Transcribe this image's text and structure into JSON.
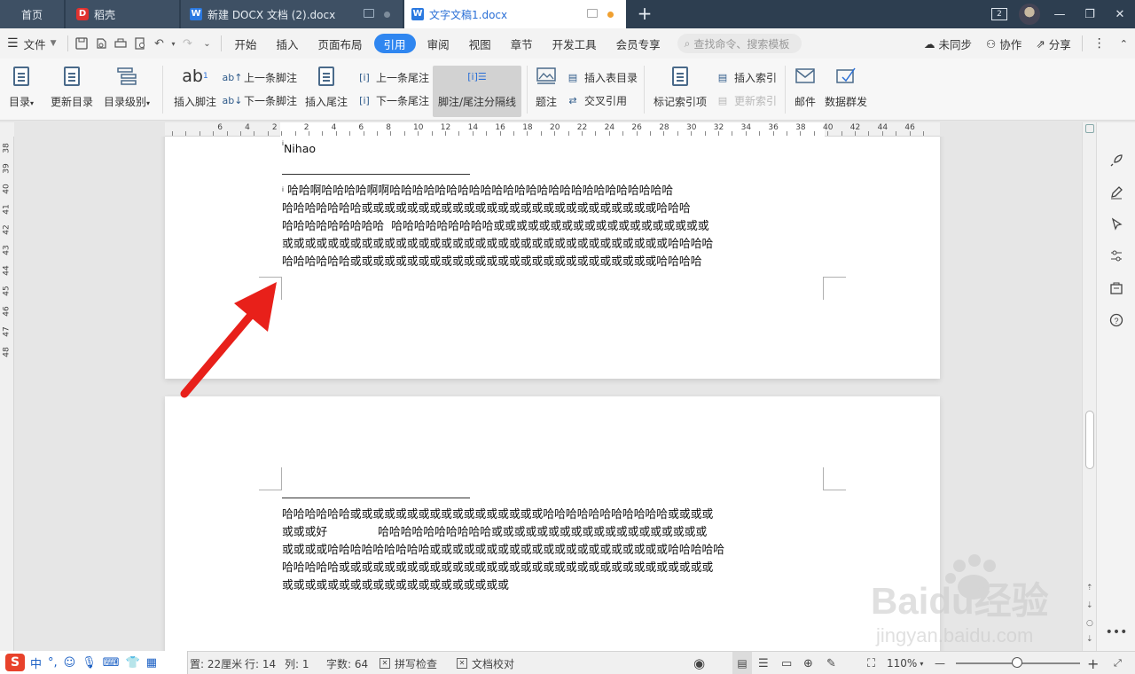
{
  "tabs": {
    "home": "首页",
    "daoke": "稻壳",
    "doc1": "新建 DOCX 文档 (2).docx",
    "doc2": "文字文稿1.docx",
    "add": "+"
  },
  "window": {
    "badge": "2",
    "minimize": "—",
    "restore": "❐",
    "close": "✕"
  },
  "menu": {
    "file": "文件",
    "ribbon_tabs": [
      "开始",
      "插入",
      "页面布局",
      "引用",
      "审阅",
      "视图",
      "章节",
      "开发工具",
      "会员专享"
    ],
    "search_placeholder": "查找命令、搜索模板",
    "sync": "未同步",
    "collab": "协作",
    "share": "分享"
  },
  "ribbon": {
    "toc": "目录",
    "update_toc": "更新目录",
    "toc_level": "目录级别",
    "insert_footnote": "插入脚注",
    "prev_footnote": "上一条脚注",
    "next_footnote": "下一条脚注",
    "insert_endnote": "插入尾注",
    "prev_endnote": "上一条尾注",
    "next_endnote": "下一条尾注",
    "separator": "脚注/尾注分隔线",
    "caption": "题注",
    "insert_toc_table": "插入表目录",
    "cross_ref": "交叉引用",
    "mark_index": "标记索引项",
    "insert_index": "插入索引",
    "update_index": "更新索引",
    "mail": "邮件",
    "data_mail": "数据群发"
  },
  "ruler": {
    "h_left": [
      "6",
      "4",
      "2"
    ],
    "h_right": [
      "2",
      "4",
      "6",
      "8",
      "10",
      "12",
      "14",
      "16",
      "18",
      "20",
      "22",
      "24",
      "26",
      "28",
      "30",
      "32",
      "34",
      "36",
      "38",
      "40",
      "42",
      "44",
      "46"
    ],
    "v": [
      "38",
      "39",
      "40",
      "41",
      "42",
      "43",
      "44",
      "45",
      "46",
      "47",
      "48"
    ]
  },
  "document": {
    "page1_note": "Nihao",
    "page1_sup": "i",
    "page1_text_sup": "i",
    "page1_lines": [
      " 哈哈啊哈哈哈哈啊啊哈哈哈哈哈哈哈哈哈哈哈哈哈哈哈哈哈哈哈哈哈哈哈哈哈",
      "哈哈哈哈哈哈哈或或或或或或或或或或或或或或或或或或或或或或或或或或哈哈哈",
      "哈哈哈哈哈哈哈哈哈  哈哈哈哈哈哈哈哈哈或或或或或或或或或或或或或或或或或或或",
      "或或或或或或或或或或或或或或或或或或或或或或或或或或或或或或或或或或哈哈哈哈",
      "哈哈哈哈哈哈或或或或或或或或或或或或或或或或或或或或或或或或或或或哈哈哈哈"
    ],
    "page2_lines": [
      "哈哈哈哈哈哈或或或或或或或或或或或或或或或或或哈哈哈哈哈哈哈哈哈哈哈或或或或",
      "或或或好              哈哈哈哈哈哈哈哈哈哈或或或或或或或或或或或或或或或或或或或",
      "或或或或哈哈哈哈哈哈哈哈哈或或或或或或或或或或或或或或或或或或或或或哈哈哈哈哈",
      "哈哈哈哈哈或或或或或或或或或或或或或或或或或或或或或或或或或或或或或或或或或",
      "或或或或或或或或或或或或或或或或或或或或"
    ]
  },
  "status": {
    "ime_lang": "中",
    "ime_punct": "°,",
    "page_height": "置: 22厘米",
    "row": "行: 14",
    "col": "列: 1",
    "word_count": "字数: 64",
    "spell_check": "拼写检查",
    "doc_proof": "文档校对",
    "zoom": "110%",
    "zoom_minus": "—",
    "zoom_plus": "+"
  },
  "watermark": {
    "brand": "Baidu经验",
    "url": "jingyan.baidu.com"
  },
  "colors": {
    "accent": "#2f86f0",
    "title_bg": "#2d3e50",
    "arrow": "#e8201a"
  }
}
